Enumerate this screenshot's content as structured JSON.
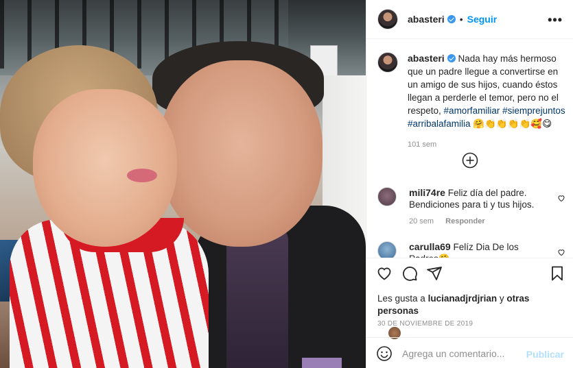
{
  "post": {
    "username": "abasteri",
    "follow_label": "Seguir",
    "dot": "•",
    "more_label": "•••"
  },
  "caption": {
    "username": "abasteri",
    "text": "Nada hay más hermoso que un padre llegue a convertirse en un amigo de sus hijos, cuando éstos llegan a perderle el temor, pero no el respeto,",
    "hashtags": [
      "#amorfamiliar",
      "#siemprejuntos",
      "#arribalafamilia"
    ],
    "emojis": "🤗👏👏👏👏🥰😋",
    "time": "101 sem"
  },
  "comments": [
    {
      "username": "mili74re",
      "text": "Feliz día del padre. Bendiciones para ti y tus hijos.",
      "time": "20 sem",
      "reply_label": "Responder"
    },
    {
      "username": "carulla69",
      "text": "Felíz Dia De los Padres🤗"
    }
  ],
  "likes": {
    "prefix": "Les gusta a",
    "user": "lucianadjrdjrian",
    "suffix": "y",
    "others": "otras personas"
  },
  "date": "30 DE NOVIEMBRE DE 2019",
  "add_comment": {
    "placeholder": "Agrega un comentario...",
    "publish_label": "Publicar"
  },
  "colors": {
    "accent": "#0095f6",
    "verified": "#3897f0",
    "hashtag": "#00376b",
    "muted": "#8e8e8e",
    "publish_disabled": "#b2dffc"
  }
}
